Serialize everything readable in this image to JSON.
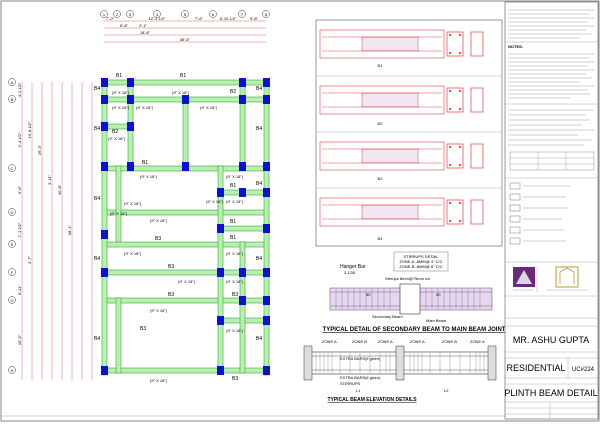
{
  "plan": {
    "grid_columns": [
      "1",
      "2",
      "3",
      "4",
      "5",
      "6",
      "7",
      "8"
    ],
    "grid_rows": [
      "A",
      "B",
      "C",
      "D",
      "E",
      "F",
      "G",
      "H"
    ],
    "top_dims": [
      "7'-0\"",
      "5'-8\"",
      "12'-1 1/2\"",
      "7'-6\"",
      "6'-10 1/2\"",
      "9'-8\"",
      "2'-1\"",
      "18'-8\"",
      "36'-5\""
    ],
    "left_dims": [
      "4'-2 1/2\"",
      "13'-8 1/2\"",
      "2'-4 1/2\"",
      "26'-5\"",
      "3'-11\"",
      "40'-8\"",
      "68'-1\"",
      "6'-6\"",
      "7'-1 1/2\"",
      "6'-11\"",
      "3'-7\"",
      "16'-5\""
    ],
    "beam_labels": [
      "B1",
      "B1",
      "B4",
      "B4",
      "B2",
      "B2",
      "B4",
      "B4",
      "B1",
      "B4",
      "B4",
      "B1",
      "B3",
      "B3",
      "B1",
      "B1",
      "B3",
      "B3",
      "B3",
      "B3",
      "B4",
      "B4",
      "B4",
      "B4"
    ],
    "beam_sizes": [
      "(9\" X 18\")",
      "(9\" X 18\")",
      "(9\" X 18\")",
      "(9\" X 18\")",
      "(9\" X 18\")",
      "(9\" X 18\")",
      "(9\" X 18\")",
      "(9\" X 18\")",
      "(9\" X 18\")",
      "(9\" X 18\")",
      "(9\" X 18\")",
      "(9\" X 18\")",
      "(9\" X 18\")",
      "(9\" X 18\")",
      "(9\" X 18\")",
      "(9\" X 18\")",
      "(9\" X 18\")",
      "(9\" X 18\")",
      "(9\" X 18\")",
      "(9\" X 18\")"
    ]
  },
  "sections": {
    "beam_names": [
      "B1",
      "B2",
      "B3",
      "B4"
    ]
  },
  "joint_detail": {
    "hanger_bar": "Hanger Bar",
    "hanger_dia": "2-12Ø",
    "stirrups_note": "Stirrups 8mm@75mm c/c",
    "stirrups_detail": "STIRRUPS DETAIL",
    "zone_a": "ZONE-A -8MM@ 4\" C/C",
    "zone_b": "ZONE-B -8MM@ 6\" C/C",
    "secondary_beam": "Secondary Beam",
    "main_beam": "Main Beam",
    "title": "TYPICAL DETAIL OF SECONDARY BEAM TO MAIN BEAM JOINT",
    "dim_50a": "50",
    "dim_50b": "50"
  },
  "elevation": {
    "extra_bars_top": "EXTRA BARS(if given)",
    "extra_bars_bottom": "EXTRA BARS(if given)",
    "stirrups": "STIRRUPS",
    "zone_labels": [
      "ZONE A",
      "ZONE B",
      "ZONE A",
      "ZONE A",
      "ZONE B",
      "ZONE A"
    ],
    "span_labels": [
      "L1",
      "L2"
    ],
    "title": "TYPICAL BEAM ELEVATION DETAILS"
  },
  "title_block": {
    "notes_heading": "NOTES:",
    "client": "MR. ASHU GUPTA",
    "project_type": "RESIDENTIAL",
    "code": "UC#224",
    "drawing_title": "PLINTH BEAM DETAIL"
  },
  "colors": {
    "beam_fill": "#b8f0b0",
    "beam_edge": "#3aa83a",
    "column": "#1010d0",
    "dimension_red": "#e04040",
    "section_red": "#d02020",
    "joint_fill": "#e6d6f2"
  }
}
